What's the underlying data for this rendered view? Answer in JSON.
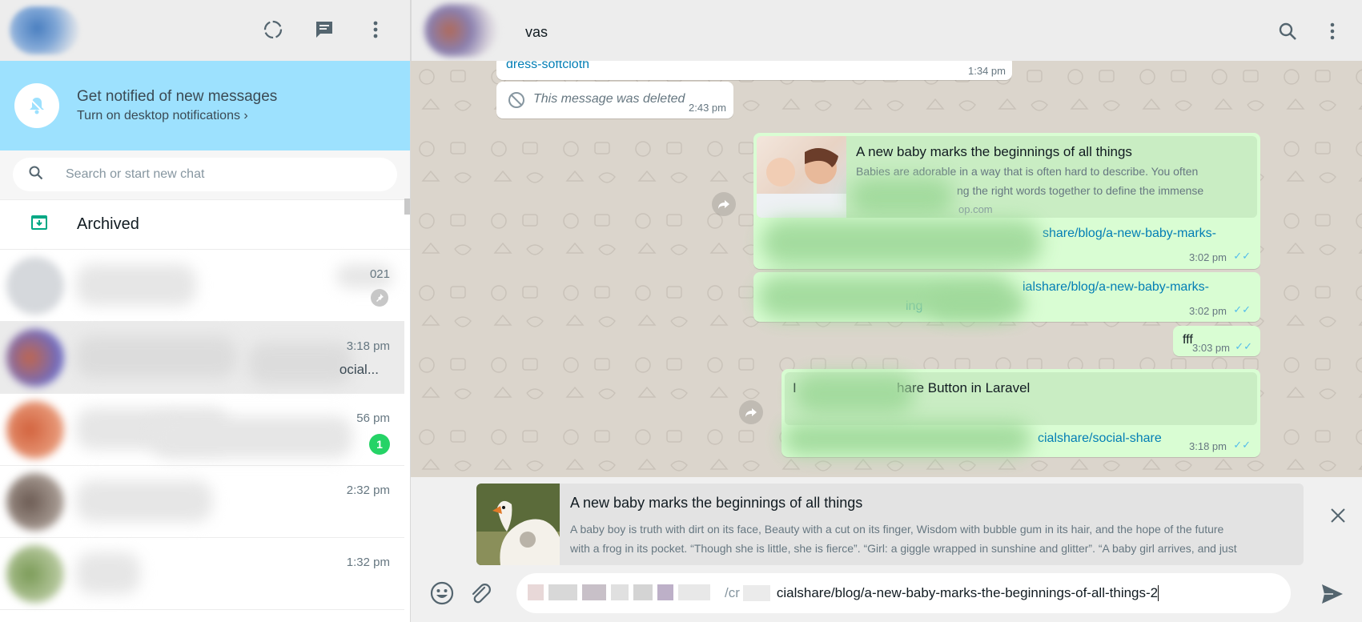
{
  "sidebar": {
    "notification": {
      "title": "Get notified of new messages",
      "link": "Turn on desktop notifications ›"
    },
    "search": {
      "placeholder": "Search or start new chat"
    },
    "archived_label": "Archived",
    "chats": [
      {
        "time": "021",
        "snippet": "",
        "unread": "",
        "pinned": true
      },
      {
        "time": "3:18 pm",
        "snippet": "ocial...",
        "unread": "",
        "pinned": false
      },
      {
        "time": "56 pm",
        "snippet": "",
        "unread": "1",
        "pinned": false
      },
      {
        "time": "2:32 pm",
        "snippet": "",
        "unread": "",
        "pinned": false
      },
      {
        "time": "1:32 pm",
        "snippet": "",
        "unread": "",
        "pinned": false
      }
    ]
  },
  "conversation": {
    "contact_name": "vas",
    "messages": [
      {
        "id": "m1",
        "link": "dress-softcloth",
        "time": "1:34 pm"
      },
      {
        "id": "m2",
        "text": "This message was deleted",
        "time": "2:43 pm"
      },
      {
        "id": "m3",
        "preview_title": "A new baby marks the beginnings of all things",
        "preview_desc_line1": "Babies are adorable in a way that is often hard to describe. You often",
        "preview_desc_line2": "ng the right words together to define the immense",
        "preview_domain": "op.com",
        "link": "share/blog/a-new-baby-marks-",
        "time": "3:02 pm"
      },
      {
        "id": "m4",
        "link": "ialshare/blog/a-new-baby-marks-",
        "link2": "ing",
        "time": "3:02 pm"
      },
      {
        "id": "m5",
        "text": "fff",
        "time": "3:03 pm"
      },
      {
        "id": "m6",
        "preview_title_prefix": "I",
        "preview_title": "hare Button in Laravel",
        "link": "cialshare/social-share",
        "time": "3:18 pm"
      }
    ]
  },
  "link_preview": {
    "title": "A new baby marks the beginnings of all things",
    "desc_line1": "A baby boy is truth with dirt on its face, Beauty with a cut on its finger, Wisdom with bubble gum in its hair, and the hope of the future",
    "desc_line2": "with a frog in its pocket.   “Though she is little, she is fierce”. “Girl: a giggle wrapped in sunshine and glitter”. “A baby girl arrives, and just"
  },
  "composer": {
    "prefix_fragments": [
      "l",
      "b",
      "/cr"
    ],
    "text": "cialshare/blog/a-new-baby-marks-the-beginnings-of-all-things-2"
  },
  "colors": {
    "notification_bg": "#9de1fe",
    "outgoing_bubble": "#d9fdd3",
    "link": "#027eb5",
    "unread_badge": "#25d366",
    "read_ticks": "#53bdeb"
  }
}
